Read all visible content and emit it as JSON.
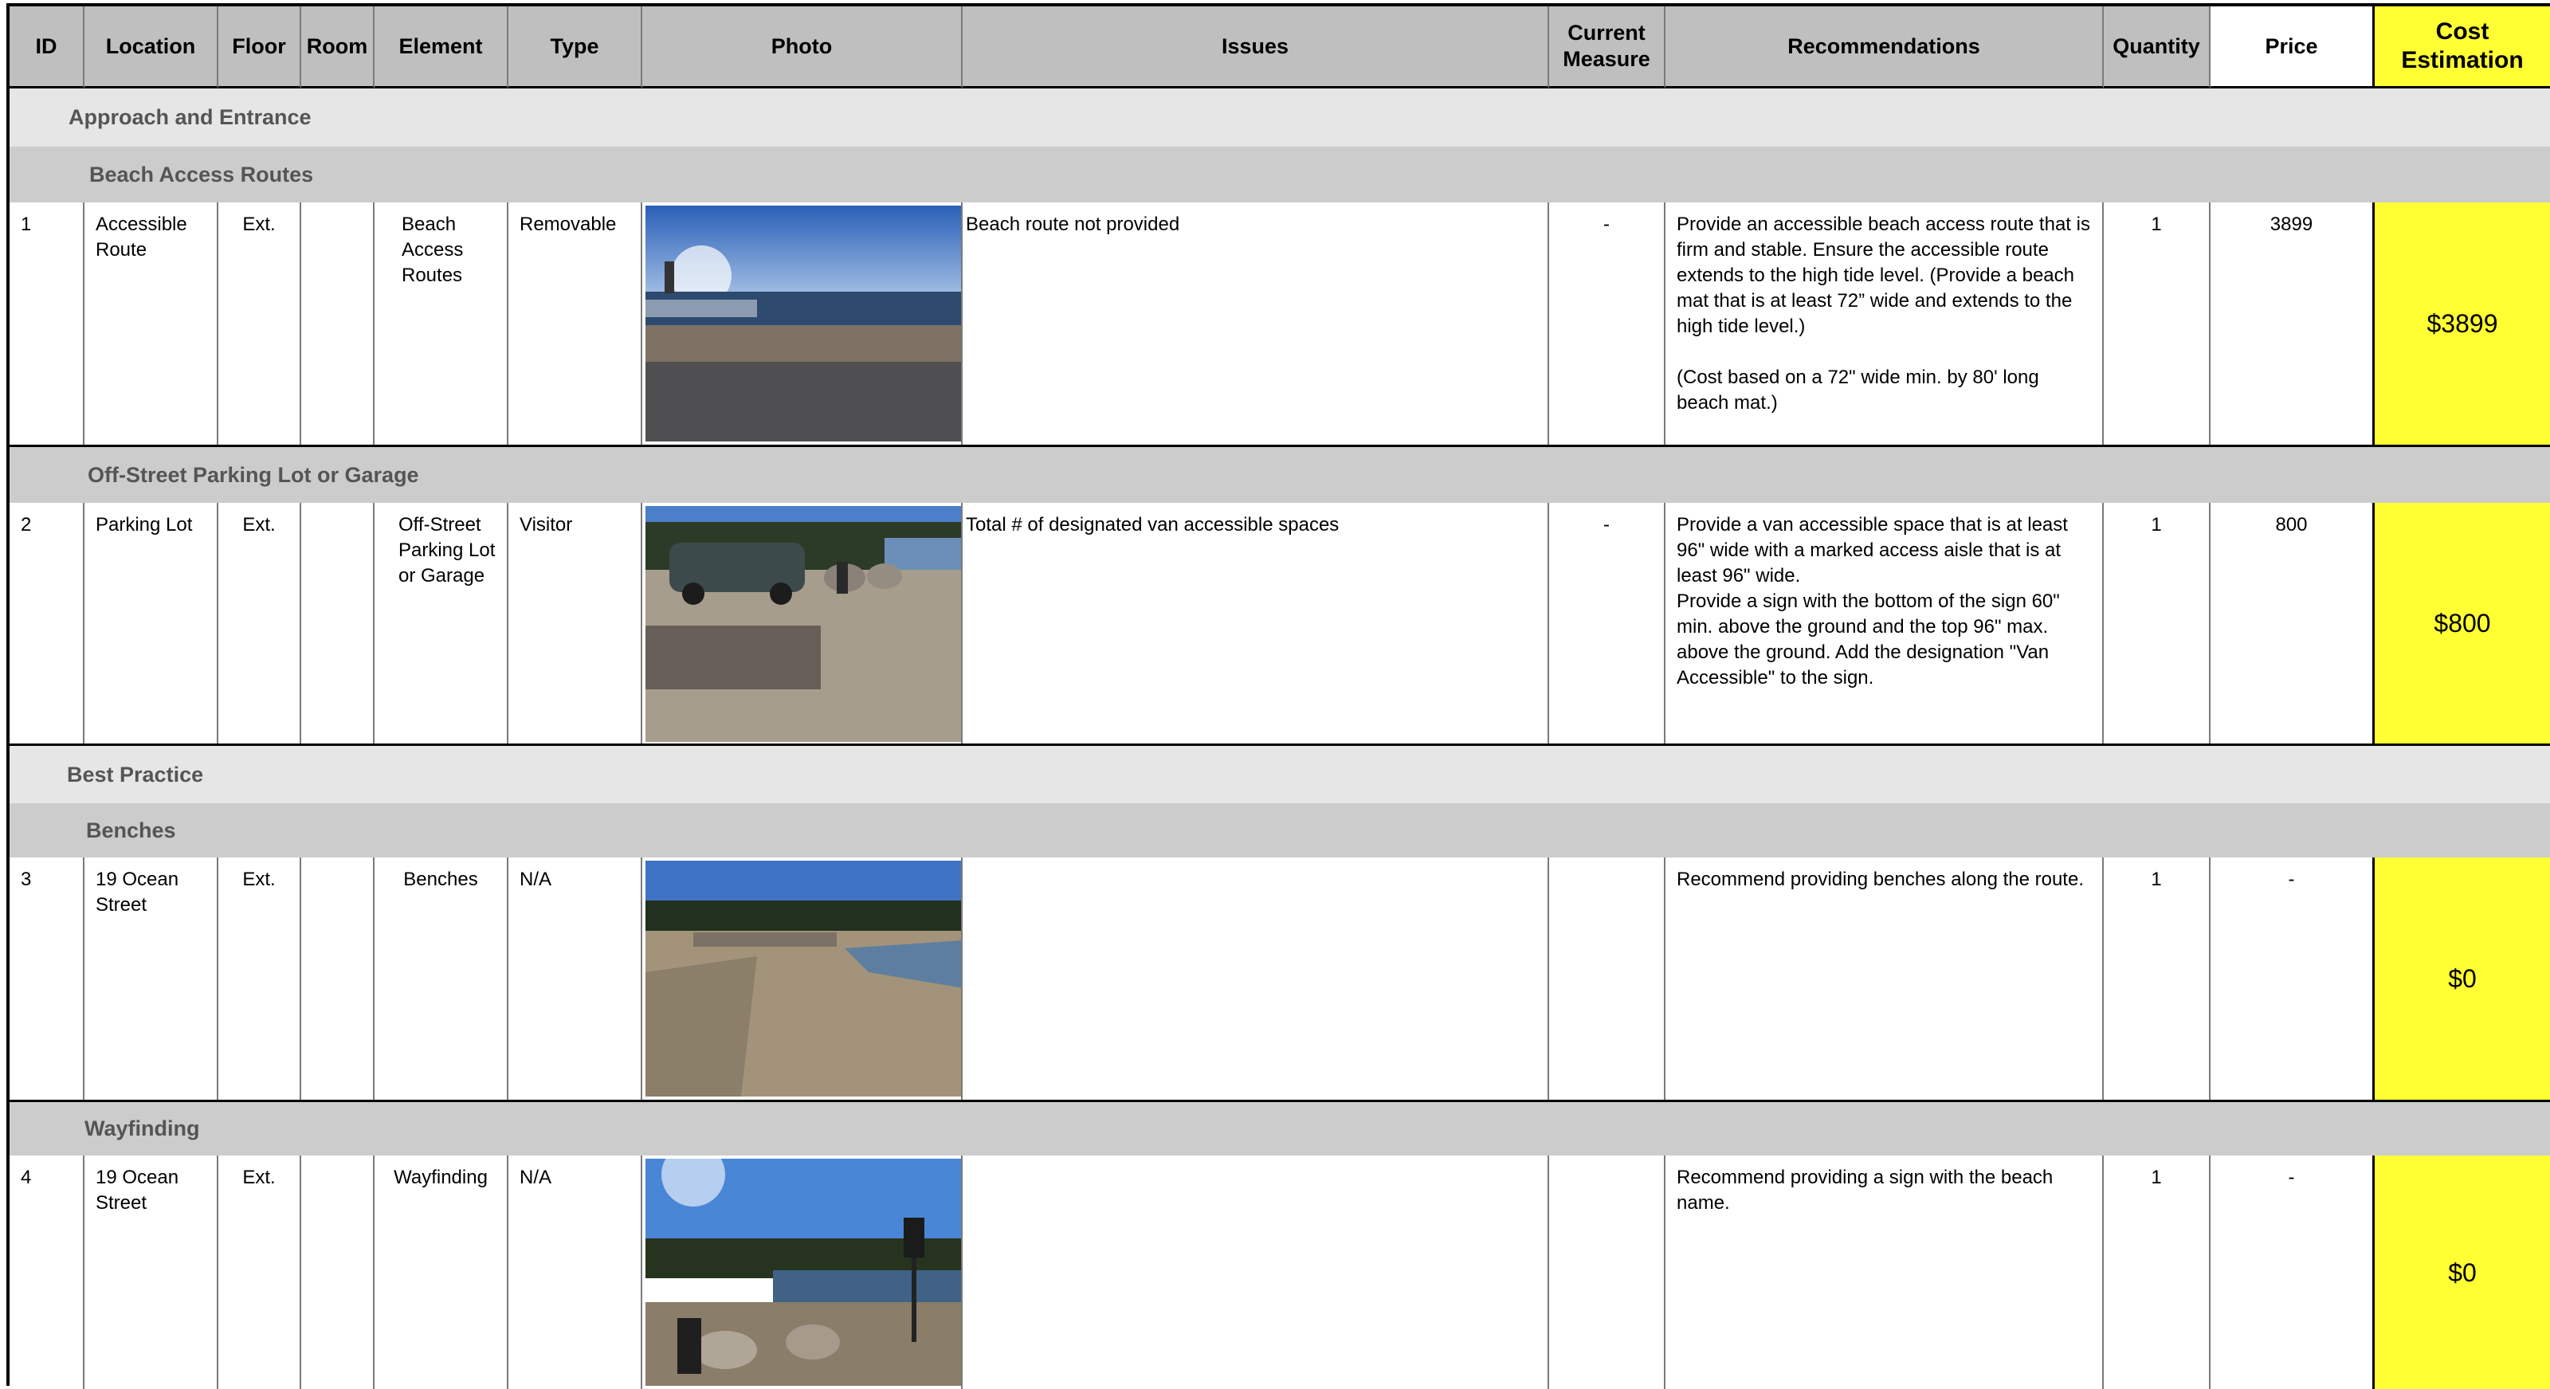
{
  "headers": {
    "id": "ID",
    "location": "Location",
    "floor": "Floor",
    "room": "Room",
    "element": "Element",
    "type": "Type",
    "photo": "Photo",
    "issues": "Issues",
    "current_measure": "Current\nMeasure",
    "recommendations": "Recommendations",
    "quantity": "Quantity",
    "price": "Price",
    "cost_estimation": "Cost\nEstimation"
  },
  "sections": [
    {
      "title": "Approach and Entrance",
      "subsections": [
        {
          "title": "Beach Access Routes",
          "row": {
            "id": "1",
            "location": "Accessible\nRoute",
            "floor": "Ext.",
            "room": "",
            "element": "Beach\nAccess\nRoutes",
            "type": "Removable",
            "issues": "Beach route not provided",
            "current_measure": "-",
            "recommendations": "Provide an accessible beach access route that is firm and stable. Ensure the accessible route extends to the high tide level.  (Provide a beach mat that is at least 72” wide and extends to the high tide level.)\n\n(Cost based on a 72\" wide min. by 80' long beach mat.)",
            "quantity": "1",
            "price": "3899",
            "cost": "$3899"
          }
        },
        {
          "title": "Off-Street Parking Lot or Garage",
          "row": {
            "id": "2",
            "location": "Parking Lot",
            "floor": "Ext.",
            "room": "",
            "element": "Off-Street\nParking Lot\nor Garage",
            "type": "Visitor",
            "issues": "Total # of designated van accessible spaces",
            "current_measure": "-",
            "recommendations": "Provide a van accessible space that is at least 96\" wide with a marked access aisle that is at least 96\" wide.\nProvide a sign with the bottom of the sign 60\" min. above the ground and the top 96\" max. above the ground. Add the designation \"Van Accessible\" to the sign.",
            "quantity": "1",
            "price": "800",
            "cost": "$800"
          }
        }
      ]
    },
    {
      "title": "Best Practice",
      "subsections": [
        {
          "title": "Benches",
          "row": {
            "id": "3",
            "location": "19 Ocean\nStreet",
            "floor": "Ext.",
            "room": "",
            "element": "Benches",
            "type": "N/A",
            "issues": "",
            "current_measure": "",
            "recommendations": "Recommend providing benches along the route.",
            "quantity": "1",
            "price": "-",
            "cost": "$0"
          }
        },
        {
          "title": "Wayfinding",
          "row": {
            "id": "4",
            "location": "19 Ocean\nStreet",
            "floor": "Ext.",
            "room": "",
            "element": "Wayfinding",
            "type": "N/A",
            "issues": "",
            "current_measure": "",
            "recommendations": "Recommend providing a sign with the beach name.",
            "quantity": "1",
            "price": "-",
            "cost": "$0"
          }
        }
      ]
    }
  ]
}
